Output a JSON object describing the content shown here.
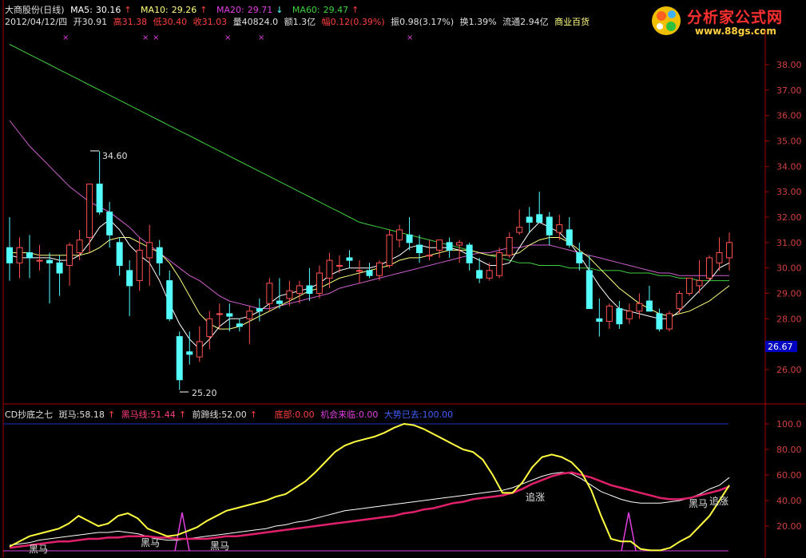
{
  "stock": {
    "name": "大商股份(日线)",
    "ma5_label": "MA5:",
    "ma5": "30.16",
    "ma10_label": "MA10:",
    "ma10": "29.26",
    "ma20_label": "MA20:",
    "ma20": "29.71",
    "ma60_label": "MA60:",
    "ma60": "29.47",
    "date": "2012/04/12/四",
    "open_label": "开",
    "open": "30.91",
    "high_label": "高",
    "high": "31.38",
    "low_label": "低",
    "low": "30.40",
    "close_label": "收",
    "close": "31.03",
    "vol_label": "量",
    "vol": "40824.0",
    "amt_label": "额",
    "amt": "1.3亿",
    "chg_label": "幅",
    "chg": "0.12(0.39%)",
    "amp_label": "振",
    "amp": "0.98(3.17%)",
    "turn_label": "换",
    "turn": "1.39%",
    "float_label": "流通",
    "float": "2.94亿",
    "sector": "商业百货"
  },
  "logo": {
    "title": "分析家公式网",
    "url": "www.88gs.com"
  },
  "indicator": {
    "name": "CD抄底之七",
    "banma_label": "斑马:",
    "banma": "58.18",
    "heima_label": "黑马线:",
    "heima": "51.44",
    "qianti_label": "前蹄线:",
    "qianti": "52.00",
    "dibu_label": "底部:",
    "dibu": "0.00",
    "jihui_label": "机会来临:",
    "jihui": "0.00",
    "dashi_label": "大势已去:",
    "dashi": "100.00"
  },
  "annotations": {
    "high_marker": "34.60",
    "low_marker": "25.20",
    "current_price": "26.67",
    "sub_labels": [
      "黑马",
      "黑马",
      "黑马",
      "追涨",
      "黑马",
      "追涨"
    ]
  },
  "price_axis": [
    "38.00",
    "37.00",
    "36.00",
    "35.00",
    "34.00",
    "33.00",
    "32.00",
    "31.00",
    "30.00",
    "29.00",
    "28.00",
    "26.00"
  ],
  "sub_axis": [
    "100.0",
    "80.00",
    "60.00",
    "40.00",
    "20.00"
  ],
  "colors": {
    "up": "#ff5050",
    "down": "#54ffff",
    "ma5": "#ffffff",
    "ma10": "#ffff80",
    "ma20": "#d060d0",
    "ma60": "#40d040",
    "grid": "#a00000"
  },
  "chart_data": {
    "type": "candlestick",
    "candles": [
      [
        30.8,
        32.0,
        29.5,
        30.2
      ],
      [
        30.2,
        31.2,
        29.6,
        30.8
      ],
      [
        30.6,
        31.3,
        29.6,
        30.4
      ],
      [
        30.3,
        30.9,
        29.9,
        30.3
      ],
      [
        30.3,
        30.6,
        28.6,
        30.2
      ],
      [
        30.2,
        30.5,
        28.9,
        29.8
      ],
      [
        30.1,
        31.0,
        29.3,
        30.9
      ],
      [
        30.6,
        31.5,
        30.3,
        31.1
      ],
      [
        31.2,
        32.6,
        30.6,
        33.3
      ],
      [
        33.3,
        34.6,
        32.1,
        32.2
      ],
      [
        32.2,
        32.6,
        30.8,
        31.3
      ],
      [
        31.0,
        31.2,
        29.7,
        30.1
      ],
      [
        29.9,
        30.3,
        28.1,
        29.3
      ],
      [
        29.5,
        31.2,
        29.1,
        30.7
      ],
      [
        30.4,
        31.7,
        29.3,
        31.0
      ],
      [
        30.8,
        31.1,
        29.7,
        30.2
      ],
      [
        29.5,
        29.9,
        27.9,
        28.0
      ],
      [
        27.3,
        27.5,
        25.2,
        25.6
      ],
      [
        26.7,
        27.5,
        26.2,
        26.6
      ],
      [
        26.5,
        27.7,
        26.3,
        27.1
      ],
      [
        27.3,
        28.3,
        26.8,
        28.0
      ],
      [
        28.2,
        28.6,
        27.6,
        28.2
      ],
      [
        28.2,
        28.6,
        27.5,
        28.1
      ],
      [
        27.8,
        28.0,
        27.5,
        27.7
      ],
      [
        28.0,
        28.5,
        27.0,
        28.3
      ],
      [
        28.4,
        28.8,
        27.9,
        28.3
      ],
      [
        28.6,
        29.6,
        28.3,
        29.4
      ],
      [
        28.7,
        29.6,
        28.4,
        28.6
      ],
      [
        28.8,
        29.5,
        28.5,
        29.1
      ],
      [
        29.0,
        29.5,
        28.6,
        29.3
      ],
      [
        29.3,
        30.0,
        28.7,
        29.0
      ],
      [
        29.0,
        30.1,
        28.8,
        29.8
      ],
      [
        29.6,
        30.6,
        29.2,
        30.3
      ],
      [
        30.1,
        30.5,
        29.8,
        30.1
      ],
      [
        30.4,
        30.7,
        30.0,
        30.3
      ],
      [
        29.9,
        30.3,
        29.4,
        29.9
      ],
      [
        29.9,
        30.2,
        29.6,
        29.7
      ],
      [
        29.7,
        30.3,
        29.5,
        30.2
      ],
      [
        30.1,
        31.5,
        30.0,
        31.3
      ],
      [
        31.1,
        31.7,
        30.8,
        31.5
      ],
      [
        31.3,
        32.0,
        30.7,
        31.0
      ],
      [
        30.9,
        31.3,
        30.2,
        30.6
      ],
      [
        30.5,
        31.1,
        30.3,
        30.5
      ],
      [
        30.7,
        31.1,
        30.4,
        31.1
      ],
      [
        31.0,
        31.2,
        30.4,
        30.7
      ],
      [
        30.9,
        31.1,
        30.2,
        31.0
      ],
      [
        30.9,
        31.0,
        29.9,
        30.2
      ],
      [
        29.9,
        30.4,
        29.4,
        29.6
      ],
      [
        29.6,
        30.2,
        29.5,
        29.9
      ],
      [
        29.7,
        30.8,
        29.6,
        30.6
      ],
      [
        30.5,
        31.4,
        30.4,
        31.2
      ],
      [
        31.4,
        32.3,
        31.3,
        31.6
      ],
      [
        32.0,
        32.4,
        31.4,
        31.8
      ],
      [
        32.1,
        33.0,
        31.9,
        31.8
      ],
      [
        32.0,
        32.2,
        30.9,
        31.3
      ],
      [
        31.4,
        32.1,
        31.1,
        31.7
      ],
      [
        31.5,
        32.0,
        30.8,
        30.9
      ],
      [
        30.6,
        31.0,
        29.9,
        30.2
      ],
      [
        29.9,
        30.5,
        28.5,
        28.4
      ],
      [
        28.0,
        28.8,
        27.3,
        27.9
      ],
      [
        27.9,
        28.6,
        27.6,
        28.5
      ],
      [
        28.4,
        28.7,
        27.6,
        27.8
      ],
      [
        28.0,
        28.6,
        27.8,
        28.3
      ],
      [
        28.3,
        29.0,
        28.0,
        28.6
      ],
      [
        28.7,
        29.3,
        28.5,
        28.3
      ],
      [
        28.2,
        28.4,
        27.5,
        27.6
      ],
      [
        27.6,
        28.3,
        27.5,
        28.2
      ],
      [
        28.4,
        29.1,
        28.2,
        29.0
      ],
      [
        29.0,
        29.6,
        28.9,
        29.6
      ],
      [
        29.3,
        30.3,
        29.0,
        29.5
      ],
      [
        29.6,
        30.5,
        29.5,
        30.4
      ],
      [
        30.2,
        31.2,
        29.9,
        30.6
      ],
      [
        30.4,
        31.4,
        29.9,
        31.0
      ]
    ],
    "ma5": [
      30.5,
      30.4,
      30.4,
      30.4,
      30.4,
      30.3,
      30.3,
      30.5,
      31.0,
      31.6,
      31.9,
      31.5,
      30.9,
      30.5,
      30.2,
      29.5,
      28.6,
      27.8,
      27.2,
      26.8,
      27.2,
      27.7,
      28.0,
      28.0,
      28.1,
      28.3,
      28.6,
      28.9,
      29.0,
      29.1,
      29.2,
      29.4,
      29.7,
      29.9,
      30.0,
      30.0,
      30.0,
      30.1,
      30.3,
      30.5,
      30.8,
      30.9,
      30.8,
      30.8,
      30.8,
      30.7,
      30.5,
      30.3,
      30.1,
      30.1,
      30.2,
      30.8,
      31.4,
      31.8,
      31.6,
      31.4,
      31.0,
      30.5,
      29.9,
      29.3,
      28.8,
      28.4,
      28.3,
      28.2,
      28.1,
      28.0,
      28.0,
      28.3,
      28.7,
      29.1,
      29.5,
      30.0,
      30.2
    ],
    "ma10": [
      30.6,
      30.6,
      30.6,
      30.5,
      30.5,
      30.5,
      30.5,
      30.5,
      30.6,
      30.8,
      31.1,
      31.2,
      31.2,
      31.0,
      30.8,
      30.6,
      30.2,
      29.6,
      28.9,
      28.2,
      27.8,
      27.6,
      27.6,
      27.7,
      27.9,
      28.1,
      28.3,
      28.5,
      28.7,
      28.9,
      29.1,
      29.2,
      29.4,
      29.6,
      29.7,
      29.8,
      29.9,
      30.0,
      30.1,
      30.3,
      30.4,
      30.4,
      30.5,
      30.6,
      30.7,
      30.7,
      30.7,
      30.6,
      30.5,
      30.5,
      30.5,
      30.6,
      30.9,
      31.1,
      31.2,
      31.2,
      31.0,
      30.7,
      30.4,
      30.0,
      29.6,
      29.2,
      28.9,
      28.6,
      28.4,
      28.2,
      28.1,
      28.2,
      28.3,
      28.5,
      28.7,
      29.0,
      29.3
    ],
    "ma20": [
      35.8,
      35.3,
      34.8,
      34.4,
      34.0,
      33.6,
      33.2,
      32.9,
      32.6,
      32.4,
      32.2,
      31.9,
      31.6,
      31.2,
      30.9,
      30.6,
      30.3,
      30.0,
      29.7,
      29.5,
      29.2,
      28.9,
      28.7,
      28.6,
      28.5,
      28.4,
      28.4,
      28.5,
      28.6,
      28.7,
      28.8,
      28.9,
      29.0,
      29.2,
      29.3,
      29.4,
      29.5,
      29.6,
      29.7,
      29.8,
      29.9,
      30.0,
      30.1,
      30.2,
      30.3,
      30.4,
      30.5,
      30.6,
      30.6,
      30.7,
      30.8,
      30.8,
      30.9,
      30.9,
      30.9,
      30.8,
      30.7,
      30.6,
      30.5,
      30.4,
      30.3,
      30.2,
      30.1,
      30.0,
      29.9,
      29.8,
      29.8,
      29.7,
      29.7,
      29.7,
      29.7,
      29.7,
      29.7
    ],
    "ma60": [
      38.8,
      38.6,
      38.4,
      38.2,
      38.0,
      37.8,
      37.6,
      37.4,
      37.2,
      37.0,
      36.8,
      36.6,
      36.4,
      36.2,
      36.0,
      35.8,
      35.6,
      35.4,
      35.2,
      35.0,
      34.8,
      34.6,
      34.4,
      34.2,
      34.0,
      33.8,
      33.6,
      33.4,
      33.2,
      33.0,
      32.8,
      32.6,
      32.4,
      32.2,
      32.0,
      31.8,
      31.7,
      31.6,
      31.5,
      31.4,
      31.3,
      31.2,
      31.1,
      31.0,
      30.9,
      30.8,
      30.7,
      30.6,
      30.5,
      30.4,
      30.3,
      30.2,
      30.2,
      30.1,
      30.1,
      30.1,
      30.0,
      30.0,
      30.0,
      29.9,
      29.9,
      29.9,
      29.8,
      29.8,
      29.8,
      29.7,
      29.7,
      29.6,
      29.6,
      29.5,
      29.5,
      29.5,
      29.5
    ],
    "sub": {
      "banma": [
        4,
        8,
        12,
        14,
        16,
        18,
        22,
        28,
        24,
        20,
        22,
        28,
        30,
        26,
        18,
        15,
        12,
        13,
        16,
        19,
        24,
        28,
        32,
        34,
        36,
        38,
        40,
        43,
        45,
        50,
        55,
        62,
        70,
        78,
        83,
        86,
        88,
        90,
        93,
        97,
        100,
        99,
        96,
        92,
        88,
        84,
        80,
        78,
        72,
        60,
        46,
        46,
        54,
        66,
        74,
        76,
        74,
        70,
        62,
        48,
        28,
        10,
        8,
        8,
        2,
        1,
        1,
        3,
        8,
        12,
        20,
        28,
        40,
        52
      ],
      "heima": [
        3,
        4,
        5,
        6,
        7,
        8,
        8,
        9,
        10,
        10,
        11,
        11,
        12,
        12,
        12,
        11,
        11,
        10,
        10,
        10,
        10,
        11,
        12,
        12,
        13,
        14,
        15,
        16,
        17,
        18,
        19,
        20,
        21,
        22,
        23,
        24,
        25,
        26,
        27,
        28,
        30,
        31,
        33,
        34,
        36,
        38,
        39,
        41,
        42,
        43,
        44,
        46,
        49,
        53,
        56,
        59,
        61,
        62,
        60,
        58,
        55,
        52,
        50,
        48,
        46,
        44,
        42,
        41,
        41,
        42,
        44,
        46,
        48,
        51
      ],
      "qianti": [
        5,
        6,
        7,
        9,
        10,
        11,
        12,
        13,
        14,
        15,
        15,
        16,
        15,
        14,
        12,
        10,
        9,
        9,
        10,
        11,
        12,
        13,
        14,
        15,
        16,
        17,
        18,
        20,
        21,
        23,
        24,
        26,
        28,
        30,
        32,
        33,
        34,
        35,
        36,
        37,
        38,
        39,
        40,
        41,
        42,
        43,
        44,
        45,
        46,
        47,
        48,
        50,
        53,
        56,
        59,
        61,
        62,
        61,
        57,
        52,
        47,
        44,
        41,
        39,
        38,
        38,
        38,
        39,
        40,
        42,
        45,
        49,
        52,
        58
      ]
    }
  }
}
